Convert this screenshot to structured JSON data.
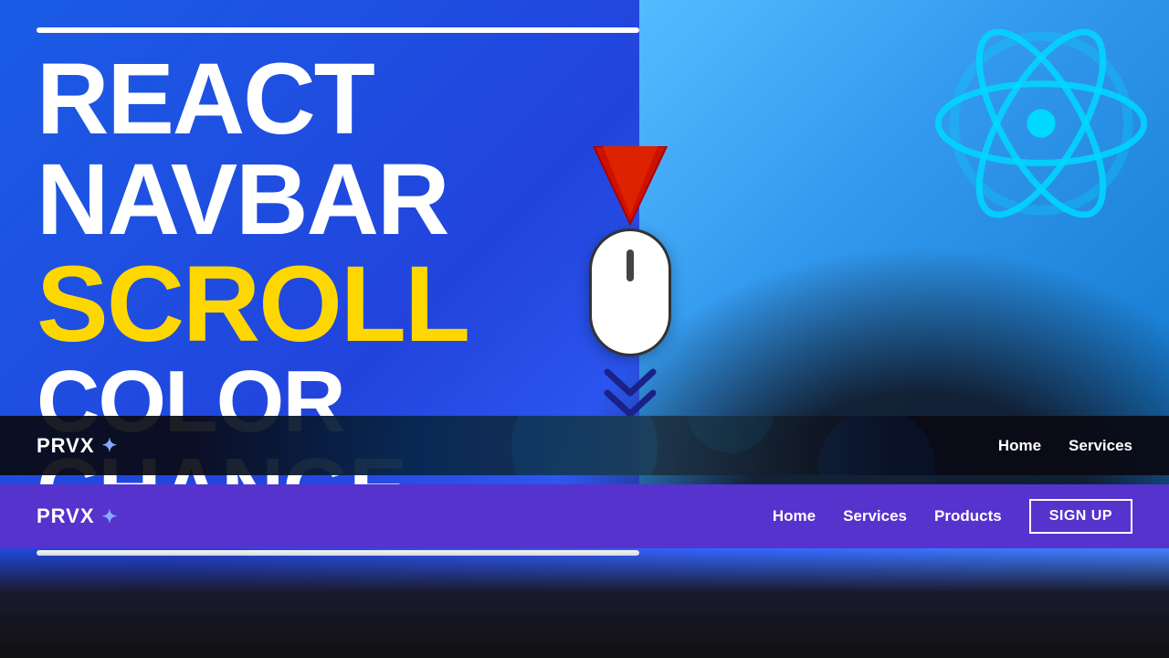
{
  "page": {
    "title": "React Navbar Scroll Color Change",
    "background_color": "#2255ee"
  },
  "thumbnail": {
    "line1": "REACT NAVBAR",
    "line2": "SCROLL",
    "line3": "COLOR CHANGE",
    "line1_color": "#FFFFFF",
    "line2_color": "#FFD700",
    "line3_color": "#FFFFFF"
  },
  "navbar1": {
    "brand": "PRVX",
    "brand_icon": "✦",
    "nav_links": [
      {
        "label": "Home"
      },
      {
        "label": "Services"
      }
    ],
    "background": "dark"
  },
  "navbar2": {
    "brand": "PRVX",
    "brand_icon": "✦",
    "nav_links": [
      {
        "label": "Home"
      },
      {
        "label": "Services"
      },
      {
        "label": "Products"
      }
    ],
    "signup_button": "SIGN UP",
    "background": "purple"
  },
  "scroll_graphic": {
    "label": "scroll down"
  }
}
